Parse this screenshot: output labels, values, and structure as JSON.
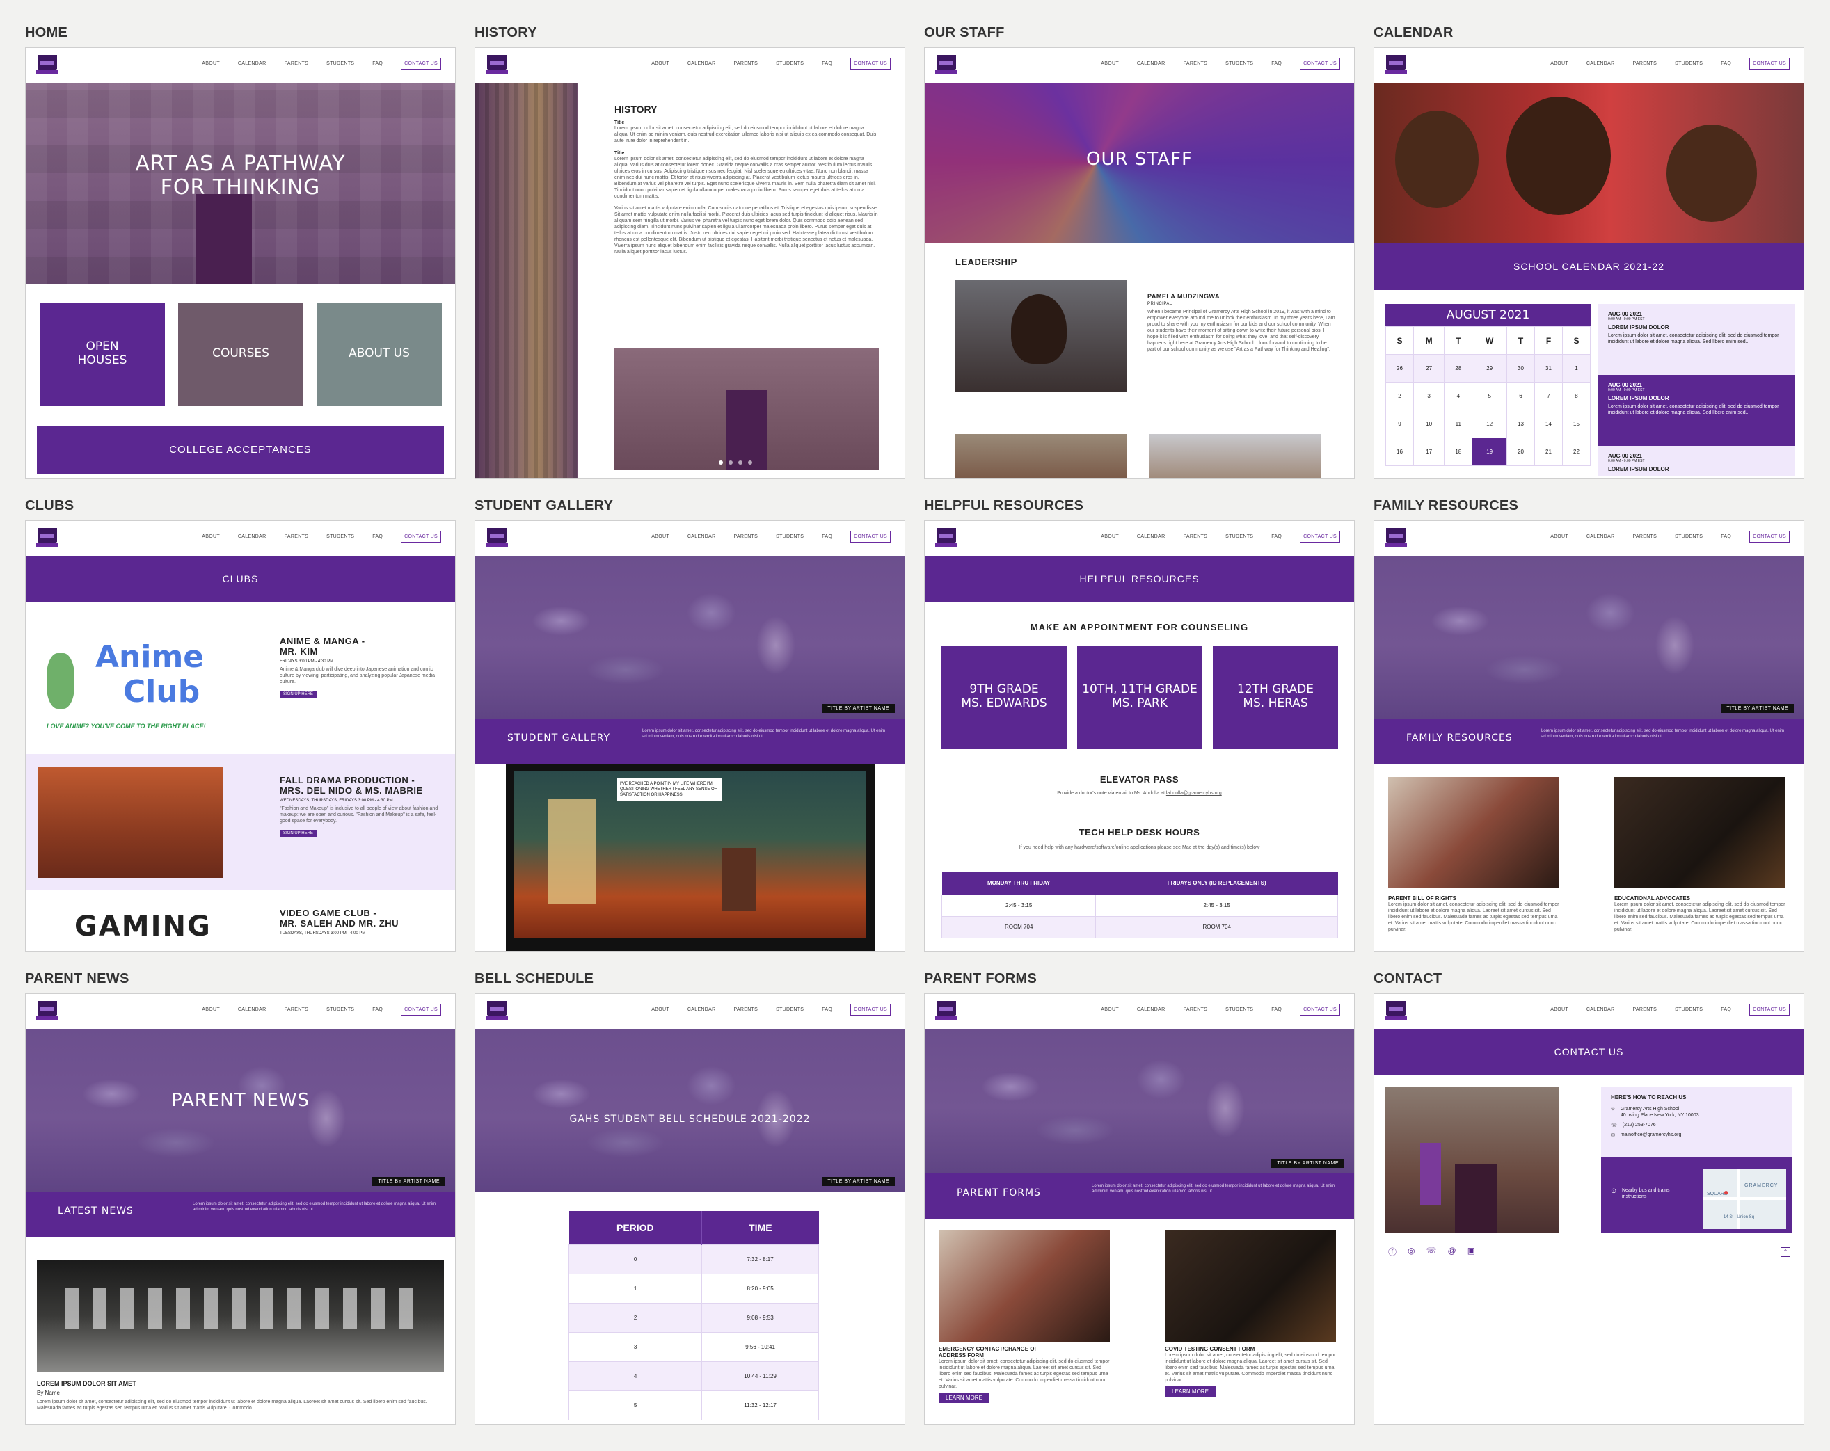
{
  "nav": {
    "about": "ABOUT",
    "calendar": "CALENDAR",
    "parents": "PARENTS",
    "students": "STUDENTS",
    "faq": "FAQ",
    "contact": "CONTACT US"
  },
  "panels": {
    "home": {
      "label": "HOME",
      "hero_line1": "ART AS A PATHWAY",
      "hero_line2": "FOR THINKING",
      "tile1_line1": "OPEN",
      "tile1_line2": "HOUSES",
      "tile2": "COURSES",
      "tile3": "ABOUT US",
      "cta": "COLLEGE ACCEPTANCES"
    },
    "history": {
      "label": "HISTORY",
      "heading": "HISTORY",
      "sub1": "Title",
      "p1": "Lorem ipsum dolor sit amet, consectetur adipiscing elit, sed do eiusmod tempor incididunt ut labore et dolore magna aliqua. Ut enim ad minim veniam, quis nostrud exercitation ullamco laboris nisi ut aliquip ex ea commodo consequat. Duis aute irure dolor in reprehenderit in.",
      "sub2": "Title",
      "p2": "Lorem ipsum dolor sit amet, consectetur adipiscing elit, sed do eiusmod tempor incididunt ut labore et dolore magna aliqua. Varius duis at consectetur lorem donec. Gravida neque convallis a cras semper auctor. Vestibulum lectus mauris ultrices eros in cursus. Adipiscing tristique risus nec feugiat. Nisl scelerisque eu ultrices vitae. Nunc non blandit massa enim nec dui nunc mattis. Et tortor at risus viverra adipiscing at. Placerat vestibulum lectus mauris ultrices eros in. Bibendum at varius vel pharetra vel turpis. Eget nunc scelerisque viverra mauris in. Sem nulla pharetra diam sit amet nisl. Tincidunt nunc pulvinar sapien et ligula ullamcorper malesuada proin libero. Purus semper eget duis at tellus at urna condimentum mattis.",
      "p3": "Varius sit amet mattis vulputate enim nulla. Cum sociis natoque penatibus et. Tristique et egestas quis ipsum suspendisse. Sit amet mattis vulputate enim nulla facilisi morbi. Placerat duis ultricies lacus sed turpis tincidunt id aliquet risus. Mauris in aliquam sem fringilla ut morbi. Varius vel pharetra vel turpis nunc eget lorem dolor. Quis commodo odio aenean sed adipiscing diam. Tincidunt nunc pulvinar sapien et ligula ullamcorper malesuada proin libero. Purus semper eget duis at tellus at urna condimentum mattis. Justo nec ultrices dui sapien eget mi proin sed. Habitasse platea dictumst vestibulum rhoncus est pellentesque elit. Bibendum ut tristique et egestas. Habitant morbi tristique senectus et netus et malesuada. Viverra ipsum nunc aliquet bibendum enim facilisis gravida neque convallis. Nulla aliquet porttitor lacus luctus accumsan. Nulla aliquet porttitor lacus luctus."
    },
    "staff": {
      "label": "OUR STAFF",
      "hero": "OUR STAFF",
      "section": "LEADERSHIP",
      "name": "PAMELA MUDZINGWA",
      "role": "PRINCIPAL",
      "bio": "When I became Principal of Gramercy Arts High School in 2019, it was with a mind to empower everyone around me to unlock their enthusiasm. In my three years here, I am proud to share with you my enthusiasm for our kids and our school community. When our students have their moment of sitting down to write their future personal bios, I hope it is filled with enthusiasm for doing what they love, and that self-discovery happens right here at Gramercy Arts High School. I look forward to continuing to be part of our school community as we use \"Art as a Pathway for Thinking and Healing\"."
    },
    "calendar": {
      "label": "CALENDAR",
      "title": "SCHOOL CALENDAR 2021-22",
      "month": "AUGUST 2021",
      "days": [
        "S",
        "M",
        "T",
        "W",
        "T",
        "F",
        "S"
      ],
      "rows": [
        [
          "26",
          "27",
          "28",
          "29",
          "30",
          "31",
          "1"
        ],
        [
          "2",
          "3",
          "4",
          "5",
          "6",
          "7",
          "8"
        ],
        [
          "9",
          "10",
          "11",
          "12",
          "13",
          "14",
          "15"
        ],
        [
          "16",
          "17",
          "18",
          "19",
          "20",
          "21",
          "22"
        ]
      ],
      "events": [
        {
          "date": "AUG 00 2021",
          "time": "0:00 AM - 0:00 PM EST",
          "title": "LOREM IPSUM DOLOR",
          "desc": "Lorem ipsum dolor sit amet, consectetur adipiscing elit, sed do eiusmod tempor incididunt ut labore et dolore magna aliqua. Sed libero enim sed..."
        },
        {
          "date": "AUG 00 2021",
          "time": "0:00 AM - 0:00 PM EST",
          "title": "LOREM IPSUM DOLOR",
          "desc": "Lorem ipsum dolor sit amet, consectetur adipiscing elit, sed do eiusmod tempor incididunt ut labore et dolore magna aliqua. Sed libero enim sed..."
        },
        {
          "date": "AUG 00 2021",
          "time": "0:00 AM - 0:00 PM EST",
          "title": "LOREM IPSUM DOLOR",
          "desc": ""
        }
      ]
    },
    "clubs": {
      "label": "CLUBS",
      "title": "CLUBS",
      "anime_logo1": "Anime",
      "anime_logo2": "Club",
      "anime_tag": "LOVE ANIME? YOU'VE COME TO THE RIGHT PLACE!",
      "c1_title": "ANIME & MANGA -",
      "c1_title2": "MR. KIM",
      "c1_time": "FRIDAYS 3:00 PM - 4:30 PM",
      "c1_desc": "Anime & Manga club will dive deep into Japanese animation and comic culture by viewing, participating, and analyzing popular Japanese media culture.",
      "signup": "SIGN UP HERE",
      "c2_title": "FALL DRAMA PRODUCTION -",
      "c2_title2": "MRS. DEL NIDO & MS. MABRIE",
      "c2_time": "WEDNESDAYS, THURSDAYS, FRIDAYS 3:00 PM - 4:30 PM",
      "c2_desc": "\"Fashion and Makeup\" is inclusive to all people of view about fashion and makeup: we are open and curious. \"Fashion and Makeup\" is a safe, feel-good space for everybody.",
      "c3_title": "VIDEO GAME CLUB -",
      "c3_title2": "MR. SALEH AND MR. ZHU",
      "c3_time": "TUESDAYS, THURSDAYS 3:00 PM - 4:00 PM",
      "gaming": "GAMING"
    },
    "gallery": {
      "label": "STUDENT GALLERY",
      "tag": "TITLE BY ARTIST NAME",
      "band": "STUDENT GALLERY",
      "desc": "Lorem ipsum dolor sit amet, consectetur adipiscing elit, sed do eiusmod tempor incididunt ut labore et dolore magna aliqua. Ut enim ad minim veniam, quis nostrud exercitation ullamco laboris nisi ut.",
      "comic": "I'VE REACHED A POINT IN MY LIFE WHERE I'M QUESTIONING WHETHER I FEEL ANY SENSE OF SATISFACTION OR HAPPINESS."
    },
    "helpful": {
      "label": "HELPFUL RESOURCES",
      "title": "HELPFUL RESOURCES",
      "appt": "MAKE AN APPOINTMENT FOR COUNSELING",
      "t1a": "9TH GRADE",
      "t1b": "MS. EDWARDS",
      "t2a": "10TH, 11TH GRADE",
      "t2b": "MS. PARK",
      "t3a": "12TH GRADE",
      "t3b": "MS. HERAS",
      "elev": "ELEVATOR PASS",
      "elev_text": "Provide a doctor's note via email to Ms. Abdulla at",
      "elev_email": "labdulla@gramercyhs.org",
      "tech": "TECH HELP DESK HOURS",
      "tech_text": "If you need help with any hardware/software/online applications please see Mac at the day(s) and time(s) below",
      "col1": "MONDAY THRU FRIDAY",
      "col2": "FRIDAYS ONLY (ID REPLACEMENTS)",
      "r1c1": "2:45 - 3:15",
      "r1c2": "2:45 - 3:15",
      "r2c1": "ROOM 704",
      "r2c2": "ROOM 704"
    },
    "family": {
      "label": "FAMILY RESOURCES",
      "tag": "TITLE BY ARTIST NAME",
      "band": "FAMILY RESOURCES",
      "desc": "Lorem ipsum dolor sit amet, consectetur adipiscing elit, sed do eiusmod tempor incididunt ut labore et dolore magna aliqua. Ut enim ad minim veniam, quis nostrud exercitation ullamco laboris nisi ut.",
      "i1": "PARENT BILL OF RIGHTS",
      "i2": "EDUCATIONAL ADVOCATES",
      "itext": "Lorem ipsum dolor sit amet, consectetur adipiscing elit, sed do eiusmod tempor incididunt ut labore et dolore magna aliqua. Laoreet sit amet cursus sit. Sed libero enim sed faucibus. Malesuada fames ac turpis egestas sed tempus urna et. Varius sit amet mattis vulputate. Commodo imperdiet massa tincidunt nunc pulvinar."
    },
    "parentnews": {
      "label": "PARENT NEWS",
      "hero": "PARENT NEWS",
      "tag": "TITLE BY ARTIST NAME",
      "band": "LATEST NEWS",
      "desc": "Lorem ipsum dolor sit amet, consectetur adipiscing elit, sed do eiusmod tempor incididunt ut labore et dolore magna aliqua. Ut enim ad minim veniam, quis nostrud exercitation ullamco laboris nisi ut.",
      "headline": "LOREM IPSUM DOLOR SIT AMET",
      "by": "By Name",
      "text": "Lorem ipsum dolor sit amet, consectetur adipiscing elit, sed do eiusmod tempor incididunt ut labore et dolore magna aliqua. Laoreet sit amet cursus sit. Sed libero enim sed faucibus. Malesuada fames ac turpis egestas sed tempus urna et. Varius sit amet mattis vulputate. Commodo"
    },
    "bell": {
      "label": "BELL SCHEDULE",
      "hero": "GAHS STUDENT BELL SCHEDULE 2021-2022",
      "tag": "TITLE BY ARTIST NAME",
      "col1": "PERIOD",
      "col2": "TIME",
      "rows": [
        [
          "0",
          "7:32 - 8:17"
        ],
        [
          "1",
          "8:20 - 9:05"
        ],
        [
          "2",
          "9:08 - 9:53"
        ],
        [
          "3",
          "9:56 - 10:41"
        ],
        [
          "4",
          "10:44 - 11:29"
        ],
        [
          "5",
          "11:32 - 12:17"
        ]
      ]
    },
    "forms": {
      "label": "PARENT FORMS",
      "tag": "TITLE BY ARTIST NAME",
      "band": "PARENT FORMS",
      "desc": "Lorem ipsum dolor sit amet, consectetur adipiscing elit, sed do eiusmod tempor incididunt ut labore et dolore magna aliqua. Ut enim ad minim veniam, quis nostrud exercitation ullamco laboris nisi ut.",
      "f1a": "EMERGENCY CONTACT/CHANGE OF",
      "f1b": "ADDRESS FORM",
      "f2": "COVID TESTING CONSENT FORM",
      "ftext": "Lorem ipsum dolor sit amet, consectetur adipiscing elit, sed do eiusmod tempor incididunt ut labore et dolore magna aliqua. Laoreet sit amet cursus sit. Sed libero enim sed faucibus. Malesuada fames ac turpis egestas sed tempus urna et. Varius sit amet mattis vulputate. Commodo imperdiet massa tincidunt nunc pulvinar.",
      "learn": "LEARN MORE"
    },
    "contact": {
      "label": "CONTACT",
      "title": "CONTACT US",
      "reach": "HERE'S HOW TO REACH US",
      "school": "Gramercy Arts High School",
      "addr": "40 Irving Place New York, NY 10003",
      "phone": "(212) 253-7076",
      "email": "mainoffice@gramercyhs.org",
      "transit": "Nearby bus and trains instructions",
      "map_label": "GRAMERCY",
      "map_park": "SQUARE",
      "map_station": "14 St - Union Sq"
    }
  }
}
